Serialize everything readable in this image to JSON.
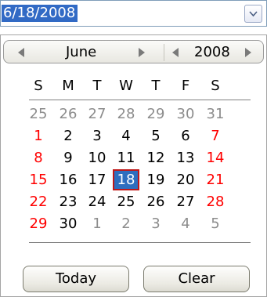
{
  "date_input": {
    "value": "6/18/2008"
  },
  "calendar": {
    "month": "June",
    "year": "2008",
    "weekdays": [
      "S",
      "M",
      "T",
      "W",
      "T",
      "F",
      "S"
    ],
    "weeks": [
      [
        {
          "d": "25",
          "o": true
        },
        {
          "d": "26",
          "o": true
        },
        {
          "d": "27",
          "o": true
        },
        {
          "d": "28",
          "o": true
        },
        {
          "d": "29",
          "o": true
        },
        {
          "d": "30",
          "o": true
        },
        {
          "d": "31",
          "o": true
        }
      ],
      [
        {
          "d": "1"
        },
        {
          "d": "2"
        },
        {
          "d": "3"
        },
        {
          "d": "4"
        },
        {
          "d": "5"
        },
        {
          "d": "6"
        },
        {
          "d": "7"
        }
      ],
      [
        {
          "d": "8"
        },
        {
          "d": "9"
        },
        {
          "d": "10"
        },
        {
          "d": "11"
        },
        {
          "d": "12"
        },
        {
          "d": "13"
        },
        {
          "d": "14"
        }
      ],
      [
        {
          "d": "15"
        },
        {
          "d": "16"
        },
        {
          "d": "17"
        },
        {
          "d": "18",
          "sel": true
        },
        {
          "d": "19"
        },
        {
          "d": "20"
        },
        {
          "d": "21"
        }
      ],
      [
        {
          "d": "22"
        },
        {
          "d": "23"
        },
        {
          "d": "24"
        },
        {
          "d": "25"
        },
        {
          "d": "26"
        },
        {
          "d": "27"
        },
        {
          "d": "28"
        }
      ],
      [
        {
          "d": "29"
        },
        {
          "d": "30"
        },
        {
          "d": "1",
          "o": true
        },
        {
          "d": "2",
          "o": true
        },
        {
          "d": "3",
          "o": true
        },
        {
          "d": "4",
          "o": true
        },
        {
          "d": "5",
          "o": true
        }
      ]
    ],
    "today_label": "Today",
    "clear_label": "Clear"
  },
  "colors": {
    "selection_fill": "#2e6ebf",
    "selection_border": "#c01818",
    "weekend_text": "#ff0000",
    "other_month_text": "#8c8c8c"
  },
  "icons": {
    "dropdown": "chevron-down-icon",
    "prev": "triangle-left-icon",
    "next": "triangle-right-icon"
  }
}
